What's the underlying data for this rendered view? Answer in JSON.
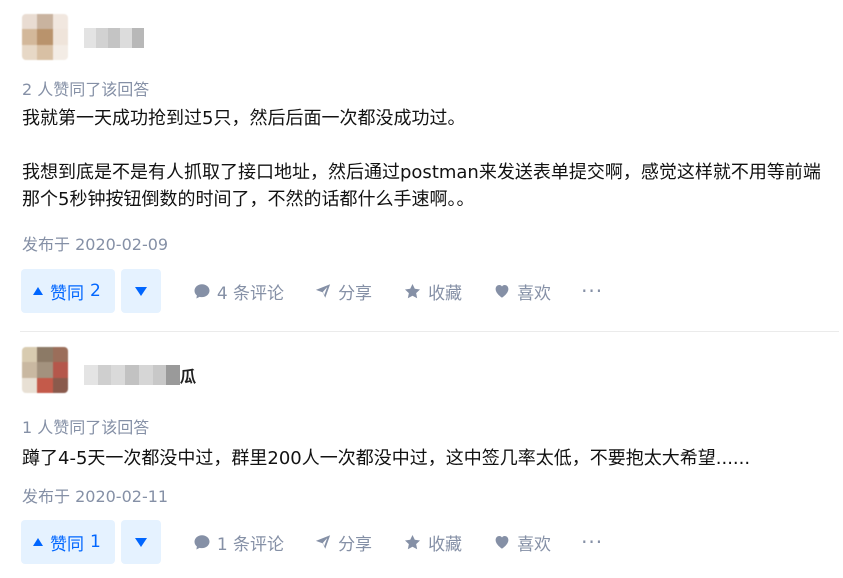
{
  "answers": [
    {
      "avatar_colors": [
        "#e9dcd2",
        "#c9b39f",
        "#f1e7df",
        "#d3b89a",
        "#b9936c",
        "#efe4da",
        "#e7d8c6",
        "#d8c0a4",
        "#f3ece5"
      ],
      "name_colors": [
        "#e3e3e3",
        "#d2d2d2",
        "#c4c4c4",
        "#dcdcdc",
        "#b8b8b8"
      ],
      "name_suffix": "",
      "vote_count_text": "2 人赞同了该回答",
      "paragraphs": [
        "我就第一天成功抢到过5只，然后后面一次都没成功过。",
        "我想到底是不是有人抓取了接口地址，然后通过postman来发送表单提交啊，感觉这样就不用等前端那个5秒钟按钮倒数的时间了，不然的话都什么手速啊。。"
      ],
      "published": "发布于 2020-02-09",
      "vote_up_label": "赞同",
      "vote_up_count": "2",
      "comment_label": "4 条评论",
      "share_label": "分享",
      "favorite_label": "收藏",
      "like_label": "喜欢",
      "more_label": "···"
    },
    {
      "avatar_colors": [
        "#d8cbb0",
        "#8c7a66",
        "#9b6e5a",
        "#c9b8a1",
        "#a3927e",
        "#b5574b",
        "#e8e0d4",
        "#c45a4a",
        "#8a5a4c"
      ],
      "name_colors": [
        "#e4e4e4",
        "#cfcfcf",
        "#dadada",
        "#c2c2c2",
        "#d6d6d6",
        "#c8c8c8",
        "#9a9a9a"
      ],
      "name_suffix": "瓜",
      "vote_count_text": "1 人赞同了该回答",
      "paragraphs": [
        "蹲了4-5天一次都没中过，群里200人一次都没中过，这中签几率太低，不要抱太大希望......"
      ],
      "published": "发布于 2020-02-11",
      "vote_up_label": "赞同",
      "vote_up_count": "1",
      "comment_label": "1 条评论",
      "share_label": "分享",
      "favorite_label": "收藏",
      "like_label": "喜欢",
      "more_label": "···"
    }
  ],
  "icons": {
    "vote_up": "triangle-up-icon",
    "vote_down": "triangle-down-icon",
    "comment": "comment-bubble-icon",
    "share": "paper-plane-icon",
    "favorite": "star-icon",
    "like": "heart-icon",
    "more": "ellipsis-icon"
  },
  "colors": {
    "accent": "#0066ff",
    "accent_bg": "#e5f2ff",
    "muted": "#8590a6",
    "text": "#121212",
    "divider": "#ebebeb"
  }
}
